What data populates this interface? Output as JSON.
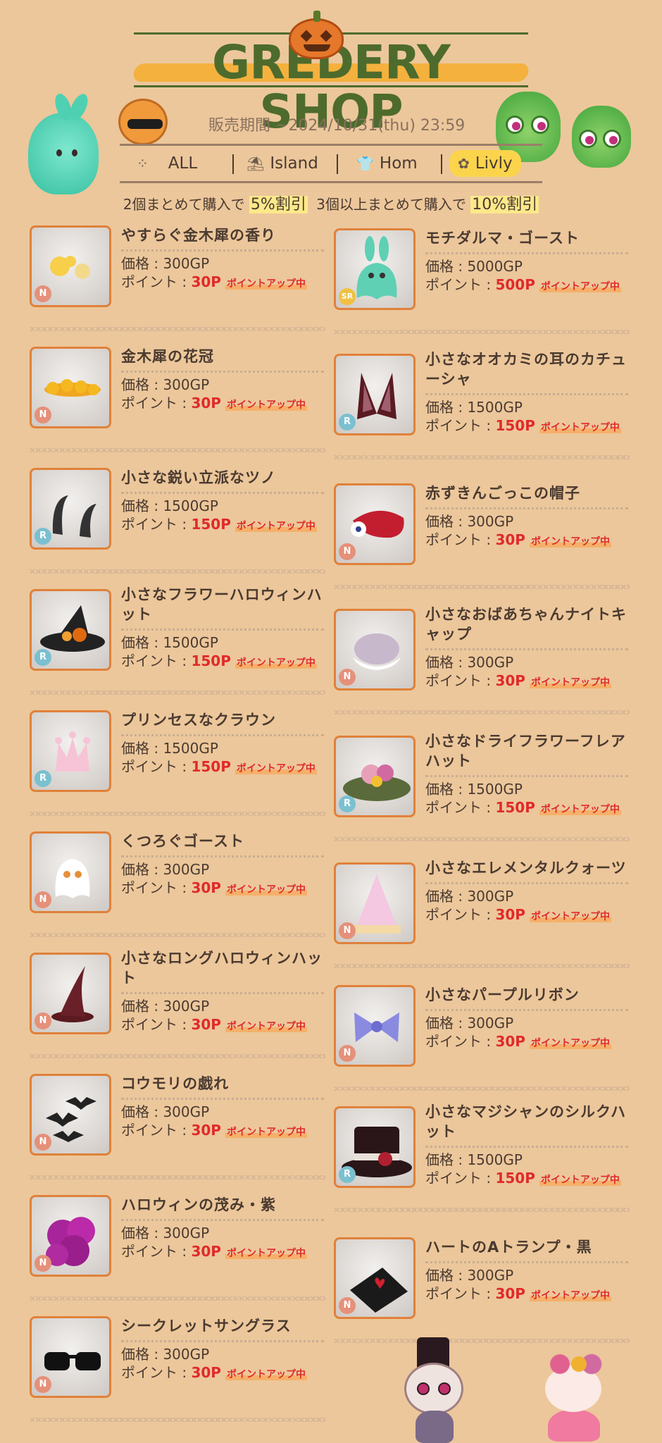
{
  "header": {
    "title": "GREDERY SHOP",
    "period": "販売期間 ~2024/10/31(thu) 23:59",
    "tabs": [
      {
        "label": "ALL",
        "icon": "dots-icon"
      },
      {
        "label": "Island",
        "icon": "island-icon"
      },
      {
        "label": "Hom",
        "icon": "shirt-icon"
      },
      {
        "label": "Livly",
        "icon": "livly-icon"
      }
    ],
    "active_tab": "Livly",
    "discount": {
      "part1": "2個まとめて購入で",
      "hl1": "5%割引",
      "part2": "3個以上まとめて購入で",
      "hl2": "10%割引"
    }
  },
  "labels": {
    "price": "価格 : ",
    "point": "ポイント : ",
    "badge": "ポイントアップ中"
  },
  "items_left": [
    {
      "name": "やすらぐ金木犀の香り",
      "price": "300GP",
      "points": "30P",
      "rarity": "N",
      "art": "osmanthus-scent"
    },
    {
      "name": "金木犀の花冠",
      "price": "300GP",
      "points": "30P",
      "rarity": "N",
      "art": "flower-crown"
    },
    {
      "name": "小さな鋭い立派なツノ",
      "price": "1500GP",
      "points": "150P",
      "rarity": "R",
      "art": "horns"
    },
    {
      "name": "小さなフラワーハロウィンハット",
      "price": "1500GP",
      "points": "150P",
      "rarity": "R",
      "art": "flower-witch-hat"
    },
    {
      "name": "プリンセスなクラウン",
      "price": "1500GP",
      "points": "150P",
      "rarity": "R",
      "art": "crown"
    },
    {
      "name": "くつろぐゴースト",
      "price": "300GP",
      "points": "30P",
      "rarity": "N",
      "art": "ghost"
    },
    {
      "name": "小さなロングハロウィンハット",
      "price": "300GP",
      "points": "30P",
      "rarity": "N",
      "art": "long-hat"
    },
    {
      "name": "コウモリの戯れ",
      "price": "300GP",
      "points": "30P",
      "rarity": "N",
      "art": "bats"
    },
    {
      "name": "ハロウィンの茂み・紫",
      "price": "300GP",
      "points": "30P",
      "rarity": "N",
      "art": "purple-bush"
    },
    {
      "name": "シークレットサングラス",
      "price": "300GP",
      "points": "30P",
      "rarity": "N",
      "art": "sunglasses"
    }
  ],
  "items_right": [
    {
      "name": "モチダルマ・ゴースト",
      "price": "5000GP",
      "points": "500P",
      "rarity": "SR",
      "art": "mochi-ghost"
    },
    {
      "name": "小さなオオカミの耳のカチューシャ",
      "price": "1500GP",
      "points": "150P",
      "rarity": "R",
      "art": "wolf-ears"
    },
    {
      "name": "赤ずきんごっこの帽子",
      "price": "300GP",
      "points": "30P",
      "rarity": "N",
      "art": "red-hood"
    },
    {
      "name": "小さなおばあちゃんナイトキャップ",
      "price": "300GP",
      "points": "30P",
      "rarity": "N",
      "art": "nightcap"
    },
    {
      "name": "小さなドライフラワーフレアハット",
      "price": "1500GP",
      "points": "150P",
      "rarity": "R",
      "art": "dry-flower-hat"
    },
    {
      "name": "小さなエレメンタルクォーツ",
      "price": "300GP",
      "points": "30P",
      "rarity": "N",
      "art": "quartz"
    },
    {
      "name": "小さなパープルリボン",
      "price": "300GP",
      "points": "30P",
      "rarity": "N",
      "art": "ribbon"
    },
    {
      "name": "小さなマジシャンのシルクハット",
      "price": "1500GP",
      "points": "150P",
      "rarity": "R",
      "art": "silk-hat"
    },
    {
      "name": "ハートのAトランプ・黒",
      "price": "300GP",
      "points": "30P",
      "rarity": "N",
      "art": "ace-card"
    }
  ],
  "colors": {
    "background": "#ecc79b",
    "accent_green": "#4d6b2d",
    "points_red": "#e02a2a",
    "thumb_border": "#e0813a",
    "tab_active": "#fbd44c"
  }
}
